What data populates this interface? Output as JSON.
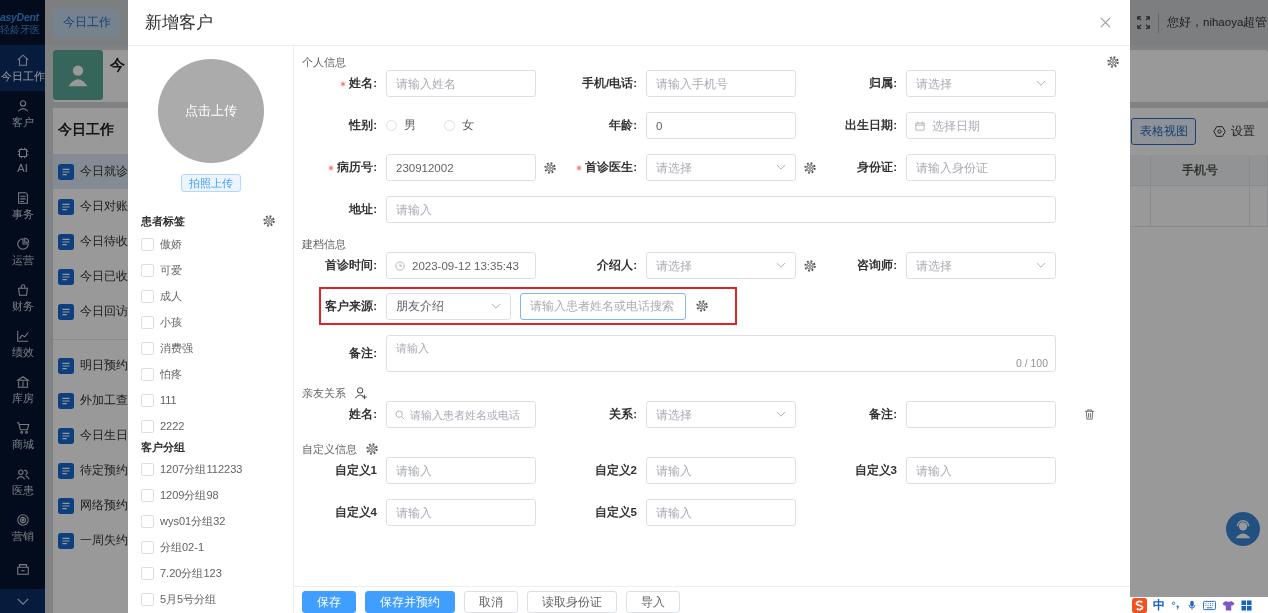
{
  "nav": {
    "logo": "asyDent",
    "logo_sub": "轻龄牙医",
    "items": [
      {
        "label": "今日工作",
        "selected": true
      },
      {
        "label": "客户",
        "selected": false
      },
      {
        "label": "AI",
        "selected": false
      },
      {
        "label": "事务",
        "selected": false
      },
      {
        "label": "运营",
        "selected": false
      },
      {
        "label": "财务",
        "selected": false
      },
      {
        "label": "绩效",
        "selected": false
      },
      {
        "label": "库房",
        "selected": false
      },
      {
        "label": "商城",
        "selected": false
      },
      {
        "label": "医患",
        "selected": false
      },
      {
        "label": "营销",
        "selected": false
      }
    ]
  },
  "topbar": {
    "tab": "今日工作",
    "greeting": "您好，nihaoya超管"
  },
  "banner": {
    "title": "今"
  },
  "today_panel": {
    "title": "今日工作",
    "groups": [
      [
        {
          "label": "今日就诊",
          "selected": true
        },
        {
          "label": "今日对账",
          "selected": false
        },
        {
          "label": "今日待收",
          "selected": false
        },
        {
          "label": "今日已收",
          "selected": false
        },
        {
          "label": "今日回访",
          "selected": false
        }
      ],
      [
        {
          "label": "明日预约",
          "selected": false
        },
        {
          "label": "外加工查",
          "selected": false
        },
        {
          "label": "今日生日",
          "selected": false
        },
        {
          "label": "待定预约",
          "selected": false
        },
        {
          "label": "网络预约",
          "selected": false
        },
        {
          "label": "一周失约",
          "selected": false
        }
      ]
    ]
  },
  "right_panel": {
    "view_button": "表格视图",
    "settings": "设置",
    "table": {
      "columns": [
        "手机号"
      ]
    }
  },
  "modal": {
    "title": "新增客户",
    "avatar": {
      "label": "点击上传"
    },
    "photo_button": "拍照上传",
    "tags": {
      "title": "患者标签",
      "items": [
        {
          "label": "傲娇",
          "checked": false
        },
        {
          "label": "可爱",
          "checked": false
        },
        {
          "label": "成人",
          "checked": false
        },
        {
          "label": "小孩",
          "checked": false
        },
        {
          "label": "消费强",
          "checked": false
        },
        {
          "label": "怕疼",
          "checked": false
        },
        {
          "label": "111",
          "checked": false
        },
        {
          "label": "2222",
          "checked": false
        }
      ]
    },
    "groups": {
      "title": "客户分组",
      "items": [
        {
          "label": "1207分组112233",
          "checked": false
        },
        {
          "label": "1209分组98",
          "checked": false
        },
        {
          "label": "wys01分组32",
          "checked": false
        },
        {
          "label": "分组02-1",
          "checked": false
        },
        {
          "label": "7.20分组123",
          "checked": false
        },
        {
          "label": "5月5号分组",
          "checked": false
        }
      ]
    },
    "form": {
      "rows": [
        {
          "kind": "section",
          "label": "个人信息"
        },
        {
          "kind": "fields",
          "fields": [
            {
              "kind": "input",
              "label": "姓名:",
              "required": true,
              "placeholder": "请输入姓名"
            },
            {
              "kind": "input",
              "label": "手机/电话:",
              "placeholder": "请输入手机号"
            },
            {
              "kind": "select",
              "label": "归属:",
              "placeholder": "请选择"
            }
          ]
        },
        {
          "kind": "fields",
          "fields": [
            {
              "kind": "radio",
              "label": "性别:",
              "options": [
                {
                  "label": "男",
                  "selected": false
                },
                {
                  "label": "女",
                  "selected": false
                }
              ]
            },
            {
              "kind": "input",
              "label": "年龄:",
              "value": "0"
            },
            {
              "kind": "date",
              "label": "出生日期:",
              "placeholder": "选择日期"
            }
          ]
        },
        {
          "kind": "fields",
          "fields": [
            {
              "kind": "input",
              "label": "病历号:",
              "required": true,
              "value": "230912002",
              "settings": true
            },
            {
              "kind": "select",
              "label": "首诊医生:",
              "required": true,
              "placeholder": "请选择",
              "settings": true
            },
            {
              "kind": "input",
              "label": "身份证:",
              "placeholder": "请输入身份证"
            }
          ]
        },
        {
          "kind": "fields",
          "fields": [
            {
              "kind": "input",
              "label": "地址:",
              "placeholder": "请输入",
              "wide": true
            }
          ]
        },
        {
          "kind": "section",
          "label": "建档信息"
        },
        {
          "kind": "fields",
          "fields": [
            {
              "kind": "datetime",
              "label": "首诊时间:",
              "value": "2023-09-12 13:35:43"
            },
            {
              "kind": "select",
              "label": "介绍人:",
              "placeholder": "请选择",
              "settings": true
            },
            {
              "kind": "select",
              "label": "咨询师:",
              "placeholder": "请选择"
            }
          ]
        },
        {
          "kind": "source",
          "label": "客户来源:",
          "value": "朋友介绍",
          "search_placeholder": "请输入患者姓名或电话搜索",
          "highlighted": true,
          "settings": true
        },
        {
          "kind": "fields",
          "fields": [
            {
              "kind": "textarea",
              "label": "备注:",
              "placeholder": "请输入",
              "counter": "0 / 100",
              "wide": true
            }
          ]
        },
        {
          "kind": "section",
          "label": "亲友关系",
          "add_button": true
        },
        {
          "kind": "fields",
          "removable": true,
          "fields": [
            {
              "kind": "search",
              "label": "姓名:",
              "placeholder": "请输入患者姓名或电话"
            },
            {
              "kind": "select",
              "label": "关系:",
              "placeholder": "请选择"
            },
            {
              "kind": "input",
              "label": "备注:"
            }
          ]
        },
        {
          "kind": "section",
          "label": "自定义信息",
          "settings": true
        },
        {
          "kind": "fields",
          "fields": [
            {
              "kind": "input",
              "label": "自定义1",
              "placeholder": "请输入"
            },
            {
              "kind": "input",
              "label": "自定义2",
              "placeholder": "请输入"
            },
            {
              "kind": "input",
              "label": "自定义3",
              "placeholder": "请输入"
            }
          ]
        },
        {
          "kind": "fields",
          "fields": [
            {
              "kind": "input",
              "label": "自定义4",
              "placeholder": "请输入"
            },
            {
              "kind": "input",
              "label": "自定义5",
              "placeholder": "请输入"
            }
          ]
        }
      ]
    },
    "buttons": [
      {
        "label": "保存",
        "kind": "primary"
      },
      {
        "label": "保存并预约",
        "kind": "primary"
      },
      {
        "label": "取消",
        "kind": "default"
      },
      {
        "label": "读取身份证",
        "kind": "default"
      },
      {
        "label": "导入",
        "kind": "default"
      }
    ]
  },
  "ime": {
    "mode": "中"
  }
}
